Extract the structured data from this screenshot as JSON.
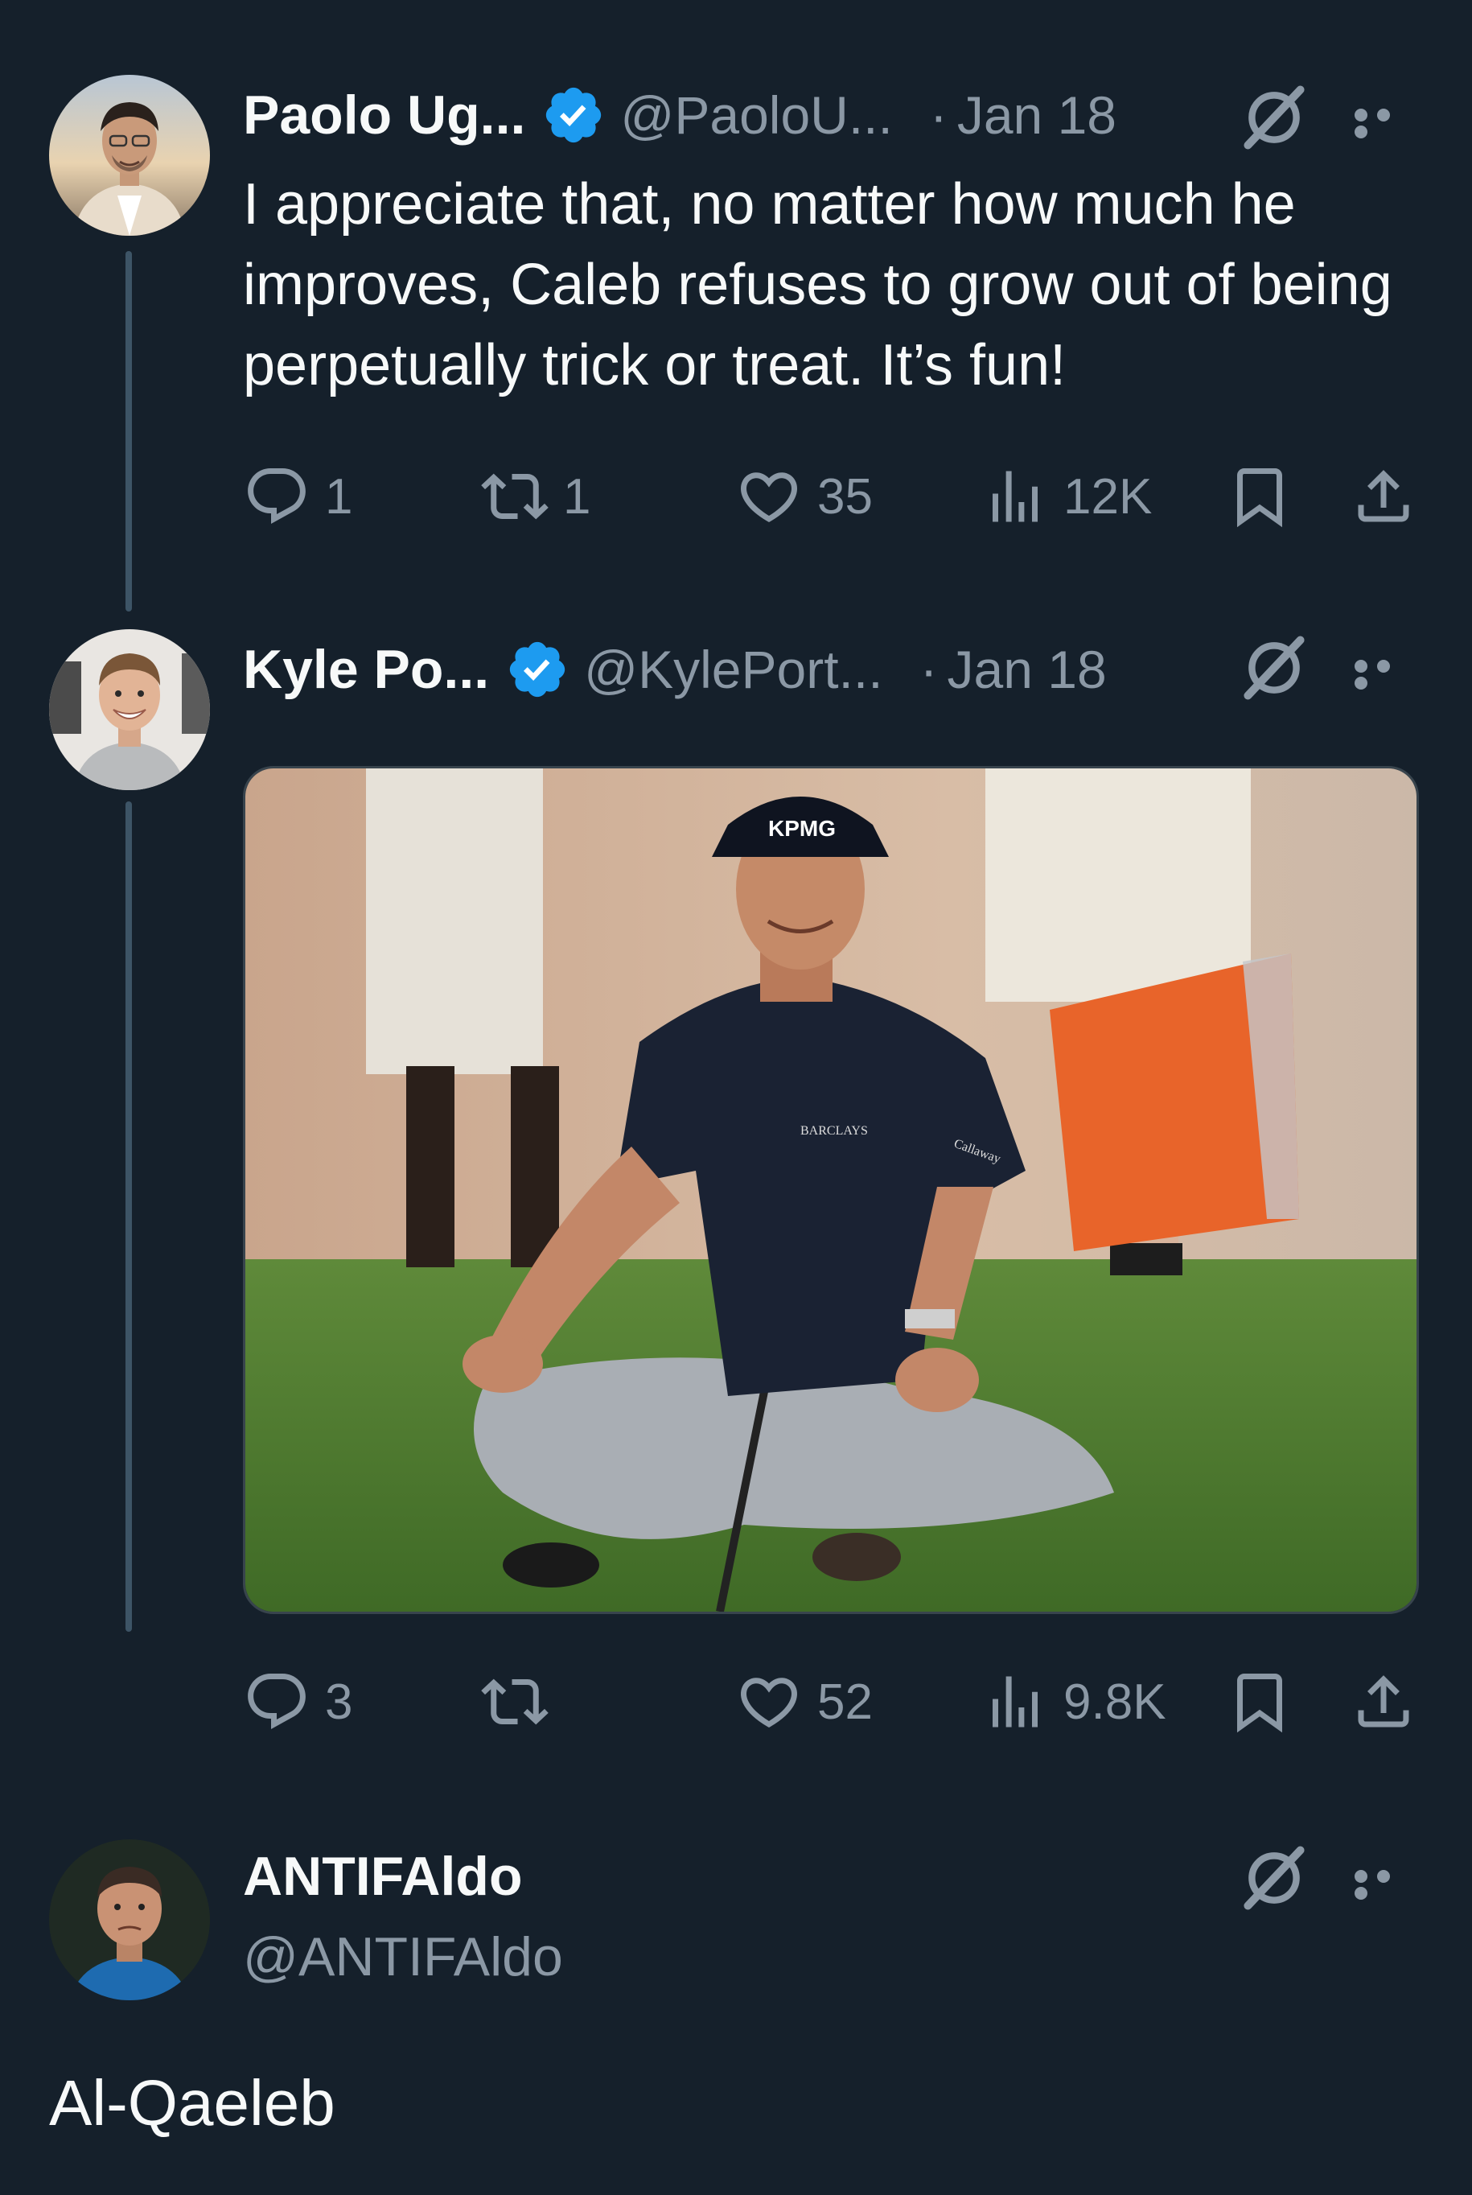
{
  "tweets": [
    {
      "display_name": "Paolo Ug...",
      "handle": "@PaoloU...",
      "date_sep": "·",
      "date": "Jan 18",
      "verified": true,
      "text": "I appreciate that, no matter how much he improves, Caleb refuses to grow out of being perpetually trick or treat. It’s fun!",
      "replies": "1",
      "retweets": "1",
      "likes": "35",
      "views": "12K"
    },
    {
      "display_name": "Kyle Po...",
      "handle": "@KylePort...",
      "date_sep": "·",
      "date": "Jan 18",
      "verified": true,
      "media": {
        "cap_text": "KPMG",
        "chest_text": "BARCLAYS",
        "sleeve_text": "Callaway"
      },
      "replies": "3",
      "retweets": "",
      "likes": "52",
      "views": "9.8K"
    },
    {
      "display_name": "ANTIFAldo",
      "handle": "@ANTIFAldo",
      "verified": false,
      "text": "Al-Qaeleb"
    }
  ],
  "colors": {
    "background": "#15202b",
    "text": "#f7f9f9",
    "secondary": "#8b98a5",
    "verified_blue": "#1d9bf0",
    "thread_line": "#3d5466"
  },
  "icons": {
    "reply": "speech-bubble-icon",
    "retweet": "retweet-icon",
    "like": "heart-icon",
    "views": "bar-chart-icon",
    "bookmark": "bookmark-icon",
    "share": "share-icon",
    "grok": "grok-icon",
    "more": "more-dots-icon"
  }
}
